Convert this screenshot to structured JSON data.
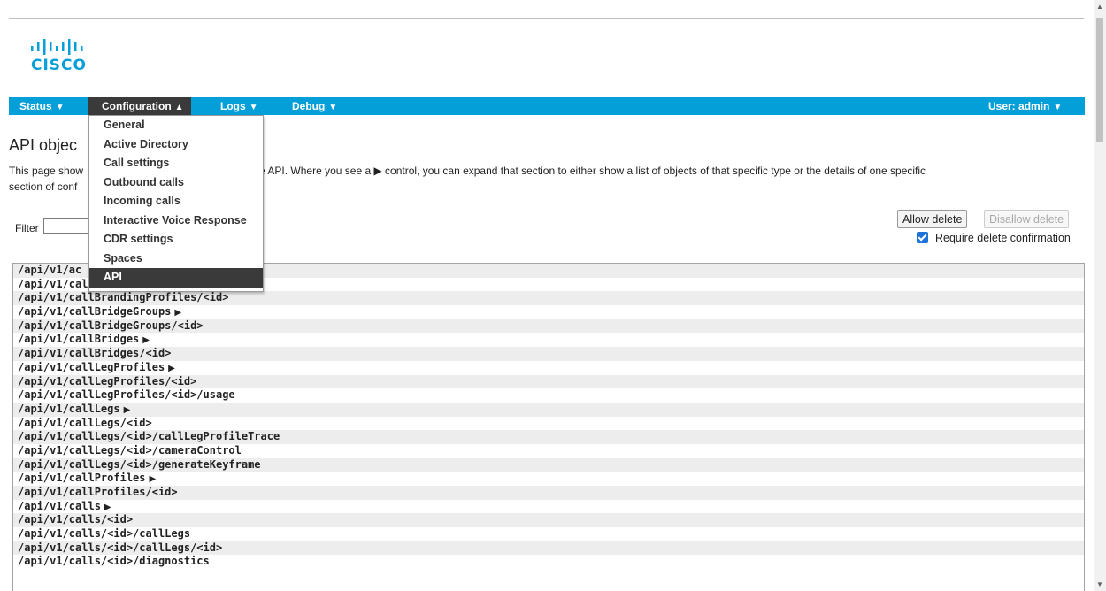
{
  "logo": {
    "word": "CISCO"
  },
  "nav": {
    "status": "Status",
    "configuration": "Configuration",
    "logs": "Logs",
    "debug": "Debug",
    "user": "User: admin",
    "caret_down": "▼",
    "caret_up": "▲"
  },
  "config_menu": [
    "General",
    "Active Directory",
    "Call settings",
    "Outbound calls",
    "Incoming calls",
    "Interactive Voice Response",
    "CDR settings",
    "Spaces",
    "API"
  ],
  "page": {
    "title": "API objec",
    "description_part1": "This page show",
    "description_part2": "by the API. Where you see a ▶ control, you can expand that section to either show a list of objects of that specific type or the details of one specific",
    "description_line2": "section of conf"
  },
  "filter": {
    "label": "Filter",
    "value": ""
  },
  "buttons": {
    "allow_delete": "Allow delete",
    "disallow_delete": "Disallow delete",
    "require_confirmation": "Require delete confirmation"
  },
  "colors": {
    "nav_bg": "#049fd9",
    "menu_selected": "#3a3a3a",
    "checkbox": "#1e73d8"
  },
  "api_rows": [
    {
      "path": "/api/v1/ac",
      "expandable": false
    },
    {
      "path": "/api/v1/cal",
      "expandable": false
    },
    {
      "path": "/api/v1/callBrandingProfiles/<id>",
      "expandable": false
    },
    {
      "path": "/api/v1/callBridgeGroups",
      "expandable": true
    },
    {
      "path": "/api/v1/callBridgeGroups/<id>",
      "expandable": false
    },
    {
      "path": "/api/v1/callBridges",
      "expandable": true
    },
    {
      "path": "/api/v1/callBridges/<id>",
      "expandable": false
    },
    {
      "path": "/api/v1/callLegProfiles",
      "expandable": true
    },
    {
      "path": "/api/v1/callLegProfiles/<id>",
      "expandable": false
    },
    {
      "path": "/api/v1/callLegProfiles/<id>/usage",
      "expandable": false
    },
    {
      "path": "/api/v1/callLegs",
      "expandable": true
    },
    {
      "path": "/api/v1/callLegs/<id>",
      "expandable": false
    },
    {
      "path": "/api/v1/callLegs/<id>/callLegProfileTrace",
      "expandable": false
    },
    {
      "path": "/api/v1/callLegs/<id>/cameraControl",
      "expandable": false
    },
    {
      "path": "/api/v1/callLegs/<id>/generateKeyframe",
      "expandable": false
    },
    {
      "path": "/api/v1/callProfiles",
      "expandable": true
    },
    {
      "path": "/api/v1/callProfiles/<id>",
      "expandable": false
    },
    {
      "path": "/api/v1/calls",
      "expandable": true
    },
    {
      "path": "/api/v1/calls/<id>",
      "expandable": false
    },
    {
      "path": "/api/v1/calls/<id>/callLegs",
      "expandable": false
    },
    {
      "path": "/api/v1/calls/<id>/callLegs/<id>",
      "expandable": false
    },
    {
      "path": "/api/v1/calls/<id>/diagnostics",
      "expandable": false
    }
  ],
  "expander_glyph": "▶"
}
